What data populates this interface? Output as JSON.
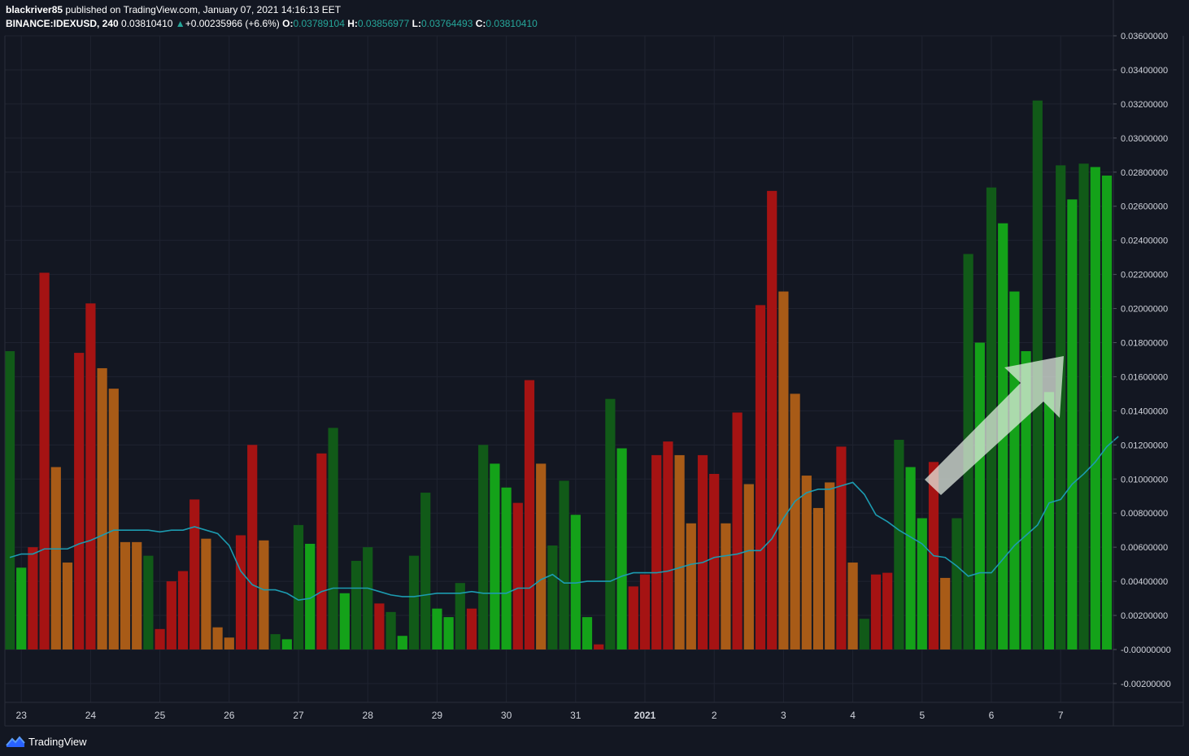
{
  "header": {
    "author": "blackriver85",
    "published_text": "published on TradingView.com, January 07, 2021 14:16:13 EET",
    "symbol": "BINANCE:IDEXUSD, 240",
    "last_price": "0.03810410",
    "change_arrow": "▲",
    "change": "+0.00235966 (+6.6%)",
    "o_label": "O:",
    "o_value": "0.03789104",
    "h_label": "H:",
    "h_value": "0.03856977",
    "l_label": "L:",
    "l_value": "0.03764493",
    "c_label": "C:",
    "c_value": "0.03810410"
  },
  "footer": {
    "brand": "TradingView",
    "logo_icon": "tradingview-logo-icon"
  },
  "colors": {
    "background": "#131722",
    "grid": "#1f2330",
    "axis_line": "#2a2e39",
    "ma_line": "#1c9bb0",
    "dark_green": "#115a18",
    "green": "#14a219",
    "red": "#a51313",
    "orange": "#a85b17",
    "arrow": "#e6f0e4"
  },
  "chart_data": {
    "type": "bar",
    "y_axis_position": "right",
    "ylim": [
      -0.0031,
      0.036
    ],
    "ytick_labels": [
      "0.03600000",
      "0.03400000",
      "0.03200000",
      "0.03000000",
      "0.02800000",
      "0.02600000",
      "0.02400000",
      "0.02200000",
      "0.02000000",
      "0.01800000",
      "0.01600000",
      "0.01400000",
      "0.01200000",
      "0.01000000",
      "0.00800000",
      "0.00600000",
      "0.00400000",
      "0.00200000",
      "-0.00000000",
      "-0.00200000"
    ],
    "ytick_values": [
      0.036,
      0.034,
      0.032,
      0.03,
      0.028,
      0.026,
      0.024,
      0.022,
      0.02,
      0.018,
      0.016,
      0.014,
      0.012,
      0.01,
      0.008,
      0.006,
      0.004,
      0.002,
      0,
      -0.002
    ],
    "xtick_labels": [
      "23",
      "24",
      "25",
      "26",
      "27",
      "28",
      "29",
      "30",
      "31",
      "2021",
      "2",
      "3",
      "4",
      "5",
      "6",
      "7"
    ],
    "xtick_bar_index": [
      1,
      7,
      13,
      19,
      25,
      31,
      37,
      43,
      49,
      55,
      61,
      67,
      73,
      79,
      85,
      91
    ],
    "grid": true,
    "annotation": "up-arrow (green/white translucent) pointing to upper-right over last bars",
    "series": [
      {
        "kind": "histogram",
        "values": [
          0.0175,
          0.0048,
          0.006,
          0.0221,
          0.0107,
          0.0051,
          0.0174,
          0.0203,
          0.0165,
          0.0153,
          0.0063,
          0.0063,
          0.0055,
          0.0012,
          0.004,
          0.0046,
          0.0088,
          0.0065,
          0.0013,
          0.0007,
          0.0067,
          0.012,
          0.0064,
          0.0009,
          0.0006,
          0.0073,
          0.0062,
          0.0115,
          0.013,
          0.0033,
          0.0052,
          0.006,
          0.0027,
          0.0022,
          0.0008,
          0.0055,
          0.0092,
          0.0024,
          0.0019,
          0.0039,
          0.0024,
          0.012,
          0.0109,
          0.0095,
          0.0086,
          0.0158,
          0.0109,
          0.0061,
          0.0099,
          0.0079,
          0.0019,
          0.0003,
          0.0147,
          0.0118,
          0.0037,
          0.0044,
          0.0114,
          0.0122,
          0.0114,
          0.0074,
          0.0114,
          0.0103,
          0.0074,
          0.0139,
          0.0097,
          0.0202,
          0.0269,
          0.021,
          0.015,
          0.0102,
          0.0083,
          0.0098,
          0.0119,
          0.0051,
          0.0018,
          0.0044,
          0.0045,
          0.0123,
          0.0107,
          0.0077,
          0.011,
          0.0042,
          0.0077,
          0.0232,
          0.018,
          0.0271,
          0.025,
          0.021,
          0.0175,
          0.0322,
          0.0151,
          0.0284,
          0.0264,
          0.0285,
          0.0283,
          0.0278
        ],
        "colors": [
          "dg",
          "g",
          "r",
          "r",
          "o",
          "o",
          "r",
          "r",
          "o",
          "o",
          "o",
          "o",
          "dg",
          "r",
          "r",
          "r",
          "r",
          "o",
          "o",
          "o",
          "r",
          "r",
          "o",
          "dg",
          "g",
          "dg",
          "g",
          "r",
          "dg",
          "g",
          "dg",
          "dg",
          "r",
          "dg",
          "g",
          "dg",
          "dg",
          "g",
          "g",
          "dg",
          "r",
          "dg",
          "g",
          "g",
          "r",
          "r",
          "o",
          "dg",
          "dg",
          "g",
          "g",
          "r",
          "dg",
          "g",
          "r",
          "r",
          "r",
          "r",
          "o",
          "o",
          "r",
          "r",
          "o",
          "r",
          "o",
          "r",
          "r",
          "o",
          "o",
          "o",
          "o",
          "o",
          "r",
          "o",
          "dg",
          "r",
          "r",
          "dg",
          "g",
          "g",
          "r",
          "o",
          "dg",
          "dg",
          "g",
          "dg",
          "g",
          "g",
          "g",
          "dg",
          "g",
          "dg",
          "g",
          "dg",
          "g",
          "g"
        ]
      },
      {
        "kind": "line",
        "name": "",
        "values": [
          0.0054,
          0.0056,
          0.0056,
          0.0059,
          0.0059,
          0.0059,
          0.0062,
          0.0064,
          0.0067,
          0.007,
          0.007,
          0.007,
          0.007,
          0.0069,
          0.007,
          0.007,
          0.0072,
          0.007,
          0.0068,
          0.0061,
          0.0046,
          0.0038,
          0.0035,
          0.0035,
          0.0033,
          0.0029,
          0.003,
          0.0034,
          0.0036,
          0.0036,
          0.0036,
          0.0036,
          0.0034,
          0.0032,
          0.0031,
          0.0031,
          0.0032,
          0.0033,
          0.0033,
          0.0033,
          0.0034,
          0.0033,
          0.0033,
          0.0033,
          0.0036,
          0.0036,
          0.0041,
          0.0044,
          0.0039,
          0.0039,
          0.004,
          0.004,
          0.004,
          0.0043,
          0.0045,
          0.0045,
          0.0045,
          0.0046,
          0.0048,
          0.005,
          0.0051,
          0.0054,
          0.0055,
          0.0056,
          0.0058,
          0.0058,
          0.0065,
          0.0077,
          0.0087,
          0.0092,
          0.0094,
          0.0094,
          0.0096,
          0.0098,
          0.0091,
          0.0079,
          0.0075,
          0.007,
          0.0066,
          0.0062,
          0.0055,
          0.0054,
          0.0049,
          0.0043,
          0.0045,
          0.0045,
          0.0053,
          0.0061,
          0.0067,
          0.0073,
          0.0086,
          0.0088,
          0.0097,
          0.0103,
          0.011,
          0.0119,
          0.0125
        ]
      }
    ]
  }
}
